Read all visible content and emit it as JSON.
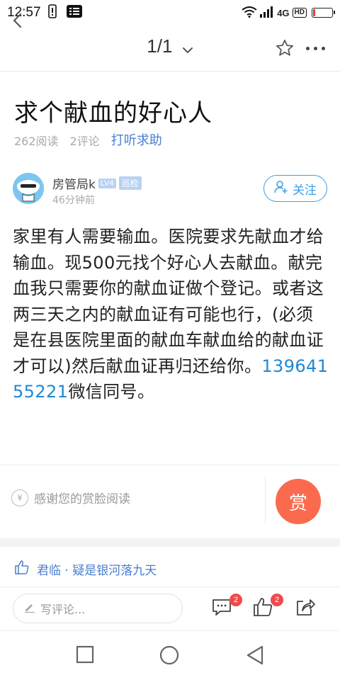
{
  "status_bar": {
    "time": "12:57",
    "network": "4G",
    "hd": "HD",
    "battery_level": 0.1
  },
  "nav": {
    "page_indicator": "1/1",
    "icons": [
      "back-icon",
      "chevron-down-icon",
      "star-icon",
      "more-icon"
    ]
  },
  "post": {
    "title": "求个献血的好心人",
    "reads": "262阅读",
    "comments": "2评论",
    "ask_help": "打听求助",
    "author": {
      "name": "房管局k",
      "level": "LV4",
      "role": "巡检",
      "time": "46分钟前",
      "follow_label": "关注"
    },
    "body_before": "家里有人需要输血。医院要求先献血才给输血。现500元找个好心人去献血。献完血我只需要你的献血证做个登记。或者这两三天之内的献血证有可能也行，(必须是在县医院里面的献血车献血给的献血证才可以)然后献血证再归还给你。",
    "phone": "13964155221",
    "body_after": "微信同号。"
  },
  "reward": {
    "thanks_text": "感谢您的赏脸阅读",
    "button_label": "赏",
    "yen": "¥"
  },
  "likes": {
    "text": "君临 · 疑是银河落九天"
  },
  "bottom_bar": {
    "comment_placeholder": "写评论...",
    "comment_count": "2",
    "like_count": "2"
  },
  "colors": {
    "accent": "#3aa0e8",
    "link": "#1e88d8",
    "reward": "#fb6a4e",
    "badge": "#f04a4a"
  }
}
